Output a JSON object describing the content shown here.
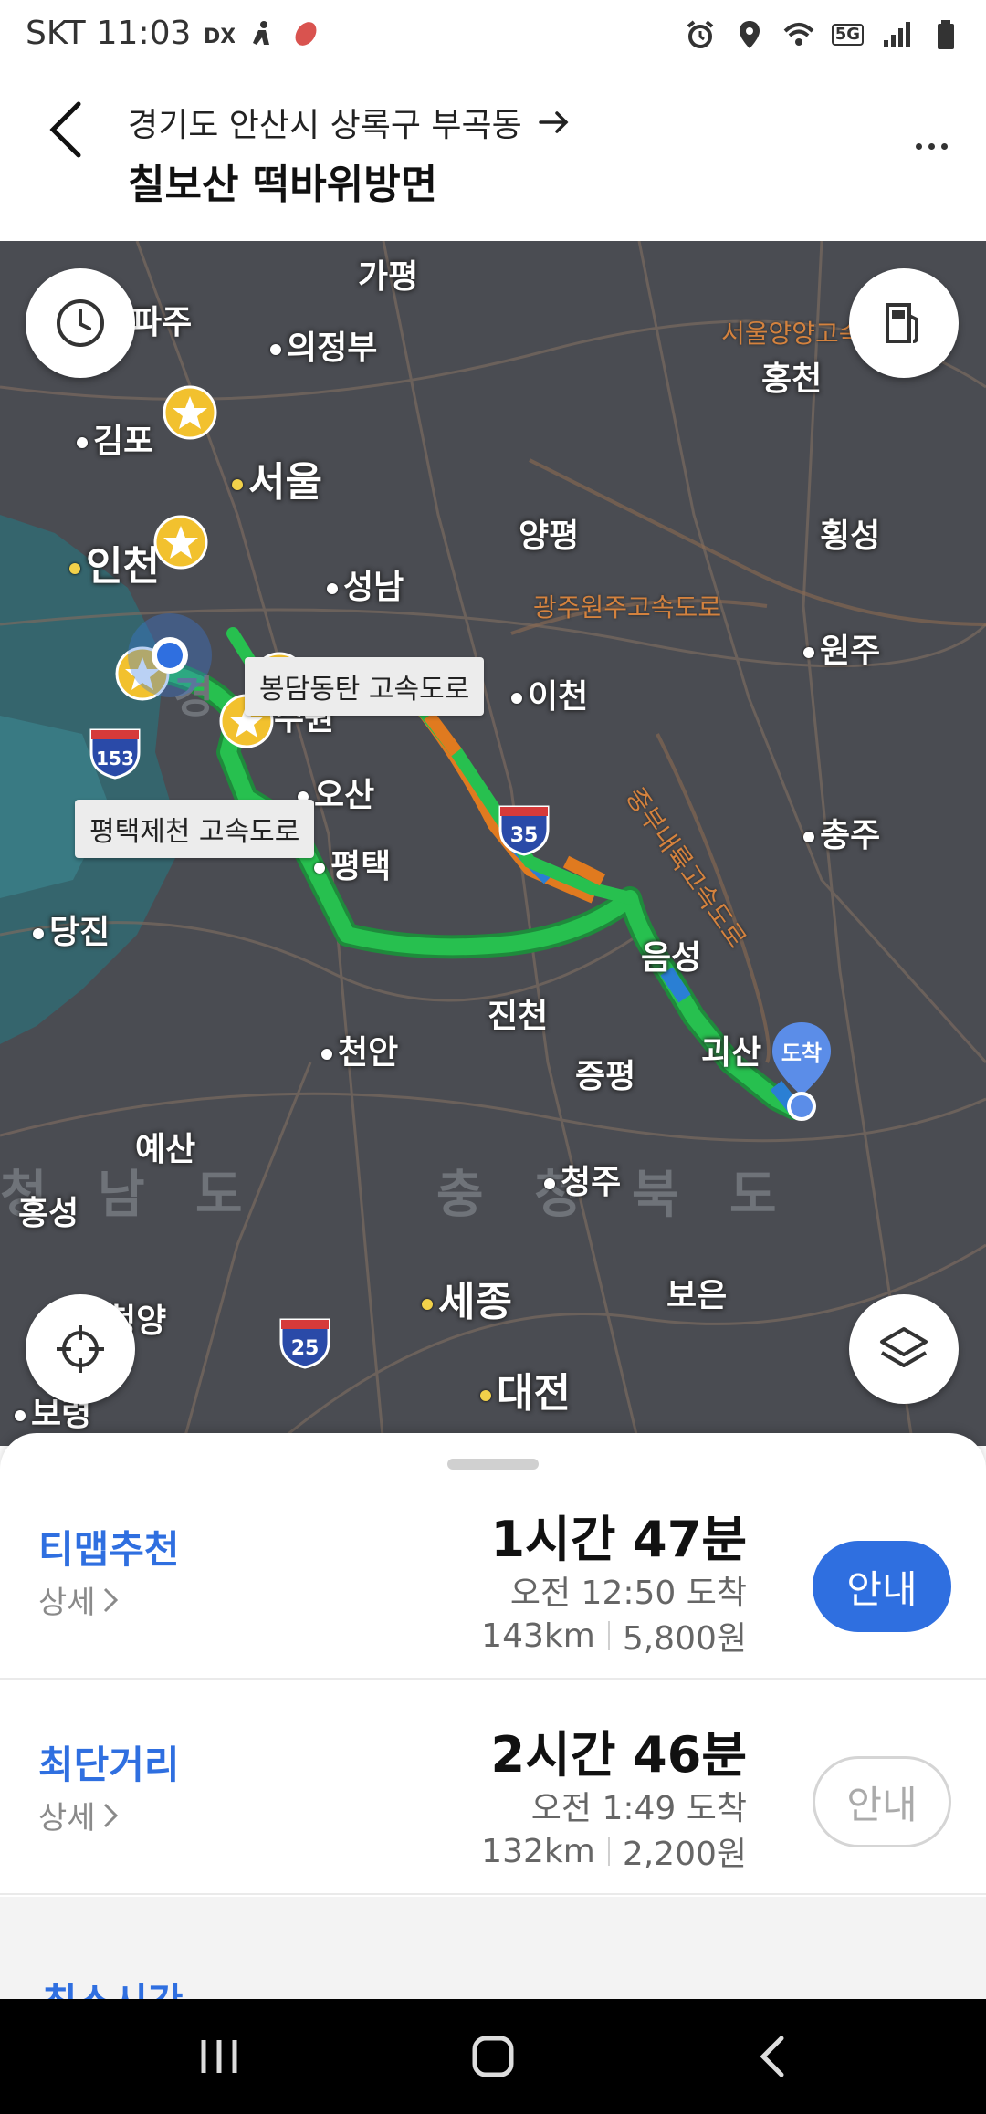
{
  "status_bar": {
    "carrier": "SKT",
    "time": "11:03",
    "network": "5G",
    "icons": [
      "dlx-icon",
      "person-icon",
      "shoe-icon",
      "alarm-icon",
      "location-icon",
      "wifi-icon",
      "signal-icon",
      "battery-icon"
    ]
  },
  "header": {
    "origin": "경기도 안산시 상록구 부곡동",
    "destination": "칠보산 떡바위방면"
  },
  "map": {
    "cities": {
      "gapyeong": "가평",
      "paju": "파주",
      "uijeongbu": "의정부",
      "gimpo": "김포",
      "seoul": "서울",
      "hongcheon": "홍천",
      "yangpyeong": "양평",
      "hoengseong": "횡성",
      "incheon": "인천",
      "seongnam": "성남",
      "wonju": "원주",
      "icheon": "이천",
      "suwon": "수원",
      "osan": "오산",
      "chungju": "충주",
      "pyeongtaek": "평택",
      "eumseong": "음성",
      "dangjin": "당진",
      "jincheon": "진천",
      "goesan": "괴산",
      "cheonan": "천안",
      "jeungpyeong": "증평",
      "yesan": "예산",
      "hongseong": "홍성",
      "cheongju": "청주",
      "sejong": "세종",
      "boeun": "보은",
      "cheongyang": "청양",
      "daejeon": "대전",
      "boryeong": "보령"
    },
    "regions": {
      "chungnam": "청 남 도",
      "chungbuk": "충 청 북 도",
      "gyeonggi": "경"
    },
    "road_labels": {
      "seoul_yangyang": "서울양양고속도로",
      "gwangju_wonju": "광주원주고속도로",
      "jungbu_naeryuk": "중부내륙고속도로"
    },
    "callouts": {
      "bongdam": "봉담동탄 고속도로",
      "pyeongtaek_jecheon": "평택제천 고속도로"
    },
    "shields": [
      "153",
      "35",
      "25"
    ],
    "arrival_label": "도착",
    "route_color": "#22b24c"
  },
  "routes": [
    {
      "name": "티맵추천",
      "detail": "상세",
      "duration": "1시간 47분",
      "arrival": "오전 12:50 도착",
      "distance": "143km",
      "toll": "5,800원",
      "button": "안내"
    },
    {
      "name": "최단거리",
      "detail": "상세",
      "duration": "2시간 46분",
      "arrival": "오전 1:49 도착",
      "distance": "132km",
      "toll": "2,200원",
      "button": "안내"
    }
  ],
  "peek_route": "최소시간",
  "colors": {
    "accent": "#2f6fe0",
    "route_green": "#22b24c",
    "traffic_orange": "#e07a1f",
    "map_bg": "#4a4c52"
  }
}
